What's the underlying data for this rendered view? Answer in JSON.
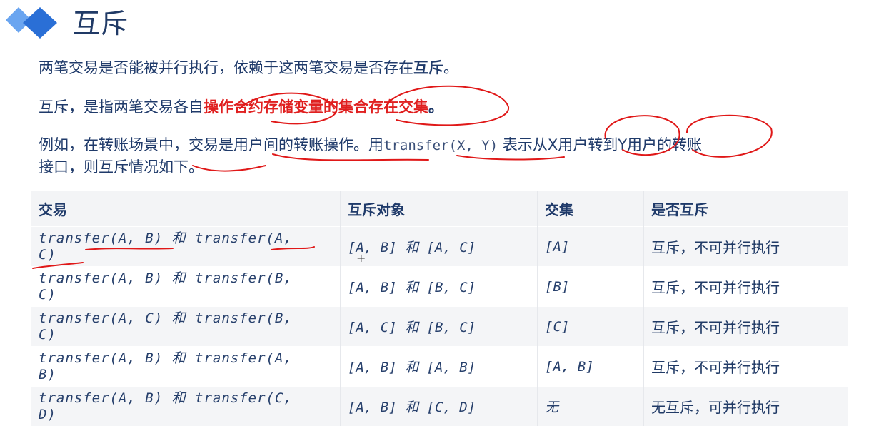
{
  "slide": {
    "title": "互斥",
    "p1": {
      "prefix": "两笔交易是否能被并行执行，依赖于这两笔交易是否存在",
      "bold": "互斥",
      "suffix": "。"
    },
    "p2": {
      "prefix": "互斥，是指两笔交易各自",
      "red": "操作合约存储变量的集合存在交集",
      "suffix": "。"
    },
    "p3": {
      "line1_prefix": "例如，在转账场景中，交易是用户间的转账操作。用",
      "line1_code": "transfer(X, Y)",
      "line1_suffix": "表示从X用户转到Y用户的转账",
      "line2": "接口，则互斥情况如下。"
    }
  },
  "table": {
    "headers": [
      "交易",
      "互斥对象",
      "交集",
      "是否互斥"
    ],
    "rows": [
      {
        "tx_line1": "transfer(A, B) 和 transfer(A,",
        "tx_line2": "C)",
        "objects": "[A, B] 和 [A, C]",
        "intersection": "[A]",
        "result": "互斥，不可并行执行"
      },
      {
        "tx_line1": "transfer(A, B) 和 transfer(B,",
        "tx_line2": "C)",
        "objects": "[A, B] 和 [B, C]",
        "intersection": "[B]",
        "result": "互斥，不可并行执行"
      },
      {
        "tx_line1": "transfer(A, C) 和 transfer(B,",
        "tx_line2": "C)",
        "objects": "[A, C] 和 [B, C]",
        "intersection": "[C]",
        "result": "互斥，不可并行执行"
      },
      {
        "tx_line1": "transfer(A, B) 和 transfer(A,",
        "tx_line2": "B)",
        "objects": "[A, B] 和 [A, B]",
        "intersection": "[A, B]",
        "result": "互斥，不可并行执行"
      },
      {
        "tx_line1": "transfer(A, B) 和 transfer(C,",
        "tx_line2": "D)",
        "objects": "[A, B] 和 [C, D]",
        "intersection": "无",
        "result": "无互斥，可并行执行"
      }
    ]
  },
  "colors": {
    "accent_blue": "#2a7be4",
    "text_navy": "#1f3a6a",
    "highlight_red": "#e02020",
    "header_bg": "#f3f4f6"
  }
}
